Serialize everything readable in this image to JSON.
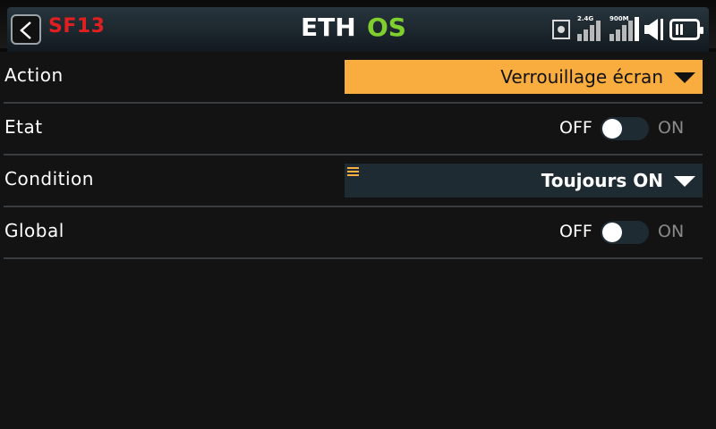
{
  "header": {
    "title": "SF13",
    "logo_left": "ETH",
    "logo_right": "OS",
    "signal_2g4_label": "2.4G",
    "signal_900m_label": "900M",
    "icons": [
      "back-icon",
      "record-icon",
      "signal-2g4-icon",
      "signal-900m-icon",
      "speaker-icon",
      "battery-icon"
    ]
  },
  "colors": {
    "title": "#e02020",
    "accent": "#f8ad3e",
    "logo_green": "#7fcf2f",
    "field_dark": "#1f2b32"
  },
  "rows": [
    {
      "label": "Action",
      "value": "Verrouillage écran"
    },
    {
      "label": "Etat",
      "off": "OFF",
      "on": "ON",
      "state": "off"
    },
    {
      "label": "Condition",
      "value": "Toujours ON"
    },
    {
      "label": "Global",
      "off": "OFF",
      "on": "ON",
      "state": "off"
    }
  ]
}
